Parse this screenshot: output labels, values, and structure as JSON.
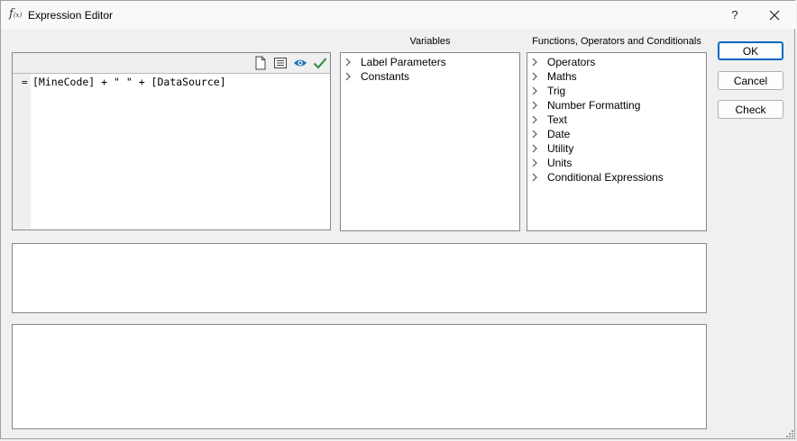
{
  "window": {
    "title": "Expression Editor",
    "help_label": "?",
    "close_label": "✕",
    "icon_main": "f",
    "icon_sub": "(x)"
  },
  "editor": {
    "equals": "=",
    "expression": "[MineCode] + \" \" + [DataSource]",
    "toolbar": [
      "new-document-icon",
      "list-icon",
      "preview-eye-icon",
      "validate-check-icon"
    ]
  },
  "variables": {
    "header": "Variables",
    "items": [
      {
        "label": "Label Parameters"
      },
      {
        "label": "Constants"
      }
    ]
  },
  "functions": {
    "header": "Functions, Operators and Conditionals",
    "items": [
      {
        "label": "Operators"
      },
      {
        "label": "Maths"
      },
      {
        "label": "Trig"
      },
      {
        "label": "Number Formatting"
      },
      {
        "label": "Text"
      },
      {
        "label": "Date"
      },
      {
        "label": "Utility"
      },
      {
        "label": "Units"
      },
      {
        "label": "Conditional Expressions"
      }
    ]
  },
  "buttons": {
    "ok": "OK",
    "cancel": "Cancel",
    "check": "Check"
  },
  "colors": {
    "accent": "#0067c0",
    "check_green": "#2e8b3a",
    "eye_blue": "#1f6fb2"
  }
}
